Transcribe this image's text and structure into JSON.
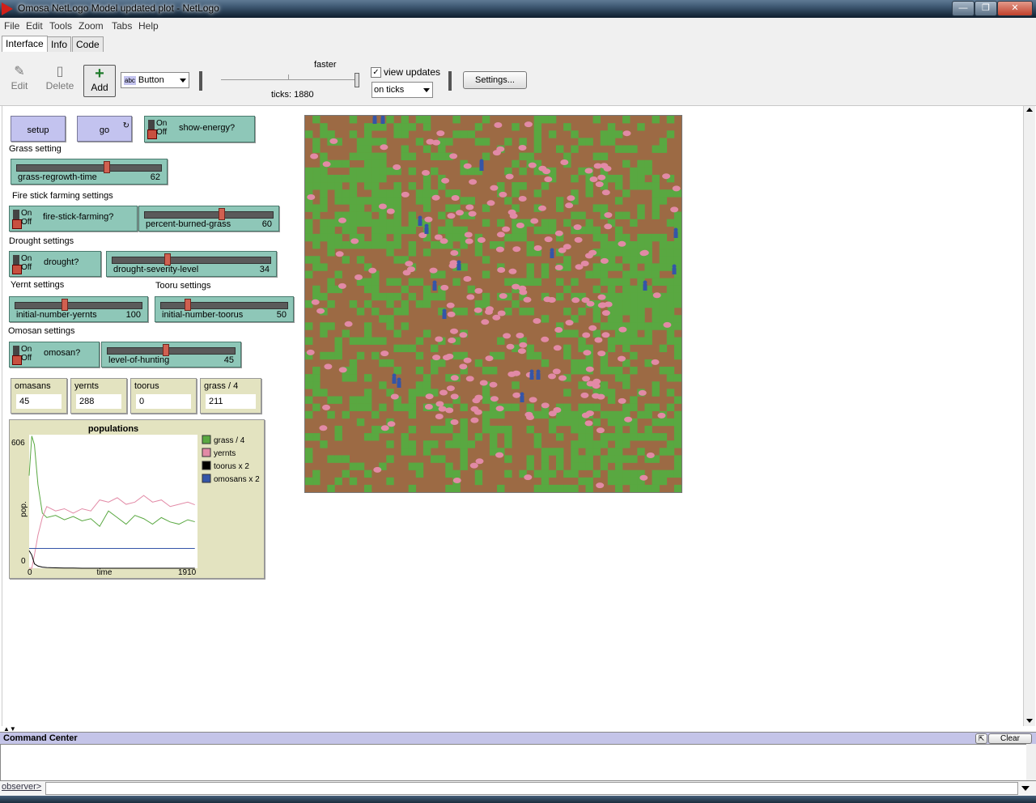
{
  "window": {
    "title": "Omosa NetLogo Model updated plot - NetLogo"
  },
  "menu": [
    "File",
    "Edit",
    "Tools",
    "Zoom",
    "Tabs",
    "Help"
  ],
  "tabs": [
    "Interface",
    "Info",
    "Code"
  ],
  "toolbar": {
    "edit_label": "Edit",
    "delete_label": "Delete",
    "add_label": "Add",
    "widget_type": "Button",
    "widget_type_icon_text": "abc",
    "speed_label": "faster",
    "ticks_label": "ticks: 1880",
    "view_updates_label": "view updates",
    "view_updates_checked": true,
    "update_mode": "on ticks",
    "settings_label": "Settings..."
  },
  "widgets": {
    "setup_label": "setup",
    "go_label": "go",
    "on_text": "On",
    "off_text": "Off",
    "show_energy_label": "show-energy?",
    "grass_setting_note": "Grass setting",
    "grass_regrowth": {
      "label": "grass-regrowth-time",
      "value": "62",
      "fraction": 0.62
    },
    "fire_note": "Fire stick farming settings",
    "fire_stick_label": "fire-stick-farming?",
    "percent_burned": {
      "label": "percent-burned-grass",
      "value": "60",
      "fraction": 0.6
    },
    "drought_note": "Drought settings",
    "drought_label": "drought?",
    "drought_severity": {
      "label": "drought-severity-level",
      "value": "34",
      "fraction": 0.34
    },
    "yernt_note": "Yernt settings",
    "tooru_note": "Tooru settings",
    "initial_yernts": {
      "label": "initial-number-yernts",
      "value": "100",
      "fraction": 0.38
    },
    "initial_toorus": {
      "label": "initial-number-toorus",
      "value": "50",
      "fraction": 0.19
    },
    "omosan_note": "Omosan settings",
    "omosan_switch_label": "omosan?",
    "level_of_hunting": {
      "label": "level-of-hunting",
      "value": "45",
      "fraction": 0.45
    }
  },
  "monitors": [
    {
      "label": "omasans",
      "value": "45"
    },
    {
      "label": "yernts",
      "value": "288"
    },
    {
      "label": "toorus",
      "value": "0"
    },
    {
      "label": "grass / 4",
      "value": "211"
    }
  ],
  "colors": {
    "grass": "#59a841",
    "dirt": "#9c6a44",
    "yernt": "#e28aa6",
    "omosan": "#3455a8",
    "tooru": "#000000",
    "button": "#c3c3ef",
    "widget": "#8ec7b8",
    "monitor": "#e3e3c0"
  },
  "chart_data": {
    "type": "line",
    "title": "populations",
    "xlabel": "time",
    "ylabel": "pop.",
    "xlim": [
      0,
      1910
    ],
    "ylim": [
      0,
      606
    ],
    "x_tick_labels": [
      "0",
      "1910"
    ],
    "y_tick_labels": [
      "0",
      "606"
    ],
    "legend_position": "right",
    "x": [
      0,
      30,
      60,
      100,
      150,
      200,
      300,
      400,
      500,
      600,
      700,
      800,
      900,
      1000,
      1100,
      1200,
      1300,
      1400,
      1500,
      1600,
      1700,
      1800,
      1880
    ],
    "series": [
      {
        "name": "grass / 4",
        "color": "#59a841",
        "values": [
          420,
          600,
          560,
          380,
          250,
          230,
          240,
          220,
          235,
          215,
          225,
          190,
          260,
          230,
          200,
          240,
          225,
          200,
          230,
          210,
          200,
          220,
          211
        ]
      },
      {
        "name": "yernts",
        "color": "#e28aa6",
        "values": [
          0,
          0,
          60,
          150,
          230,
          280,
          260,
          270,
          250,
          270,
          260,
          310,
          300,
          320,
          290,
          300,
          330,
          300,
          310,
          280,
          290,
          300,
          288
        ]
      },
      {
        "name": "toorus x 2",
        "color": "#000000",
        "values": [
          80,
          60,
          20,
          10,
          5,
          3,
          2,
          1,
          1,
          0,
          0,
          0,
          0,
          0,
          0,
          0,
          0,
          0,
          0,
          0,
          0,
          0,
          0
        ]
      },
      {
        "name": "omosans x 2",
        "color": "#3455a8",
        "values": [
          90,
          90,
          90,
          90,
          90,
          90,
          90,
          90,
          90,
          90,
          90,
          90,
          90,
          90,
          90,
          90,
          90,
          90,
          90,
          90,
          90,
          90,
          90
        ]
      }
    ]
  },
  "command_center": {
    "title": "Command Center",
    "clear_label": "Clear",
    "prompt": "observer>"
  }
}
